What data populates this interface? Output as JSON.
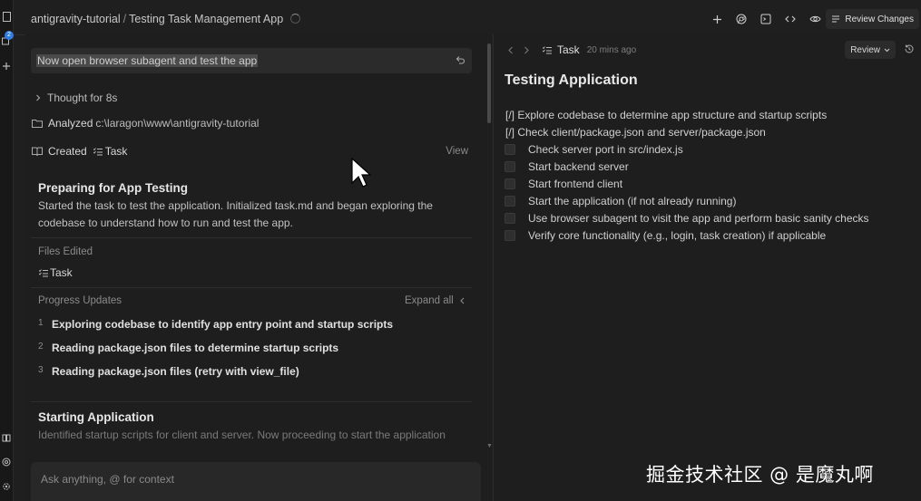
{
  "activity": {
    "notification_count": "2"
  },
  "topbar": {
    "workspace": "antigravity-tutorial",
    "separator": "/",
    "conversation_title": "Testing Task Management App",
    "review_changes_label": "Review Changes"
  },
  "chat": {
    "prompt": "Now open browser subagent and test the app",
    "thought": "Thought for 8s",
    "analyzed_label": "Analyzed",
    "analyzed_path": "c:\\laragon\\www\\antigravity-tutorial",
    "created_label": "Created",
    "created_item": "Task",
    "view_label": "View",
    "card1": {
      "title": "Preparing for App Testing",
      "text": "Started the task to test the application. Initialized task.md and began exploring the codebase to understand how to run and test the app."
    },
    "files_edited_label": "Files Edited",
    "files_edited_item": "Task",
    "progress_label": "Progress Updates",
    "expand_all_label": "Expand all",
    "progress_items": [
      {
        "n": "1",
        "text": "Exploring codebase to identify app entry point and startup scripts"
      },
      {
        "n": "2",
        "text": "Reading package.json files to determine startup scripts"
      },
      {
        "n": "3",
        "text": "Reading package.json files (retry with view_file)"
      }
    ],
    "card2": {
      "title": "Starting Application",
      "text": "Identified startup scripts for client and server. Now proceeding to start the application"
    },
    "ask_placeholder": "Ask anything, @ for context"
  },
  "task_panel": {
    "title": "Task",
    "time": "20 mins ago",
    "review_label": "Review",
    "doc_title": "Testing Application",
    "done_items": [
      "[/] Explore codebase to determine app structure and startup scripts",
      "[/] Check client/package.json and server/package.json"
    ],
    "todo_items": [
      "Check server port in src/index.js",
      "Start backend server",
      "Start frontend client",
      "Start the application (if not already running)",
      "Use browser subagent to visit the app and perform basic sanity checks",
      "Verify core functionality (e.g., login, task creation) if applicable"
    ]
  },
  "watermark": "掘金技术社区 @ 是魔丸啊",
  "colors": {
    "background": "#1f1f1f",
    "accent": "#2f7de1",
    "text": "#cccccc"
  }
}
